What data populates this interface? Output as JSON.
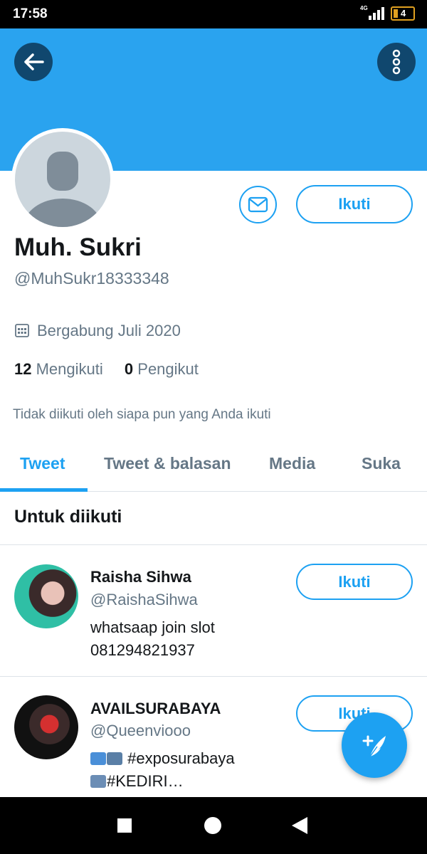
{
  "status_bar": {
    "time": "17:58",
    "network": "4G",
    "battery": "4"
  },
  "header": {
    "back_icon": "arrow-left-icon",
    "menu_icon": "more-vertical-icon"
  },
  "profile": {
    "name": "Muh. Sukri",
    "handle": "@MuhSukr18333348",
    "joined": "Bergabung Juli 2020",
    "following_count": "12",
    "following_label": "Mengikuti",
    "followers_count": "0",
    "followers_label": "Pengikut",
    "followed_by_note": "Tidak diikuti oleh siapa pun yang Anda ikuti",
    "follow_label": "Ikuti"
  },
  "tabs": [
    {
      "label": "Tweet",
      "active": true
    },
    {
      "label": "Tweet & balasan"
    },
    {
      "label": "Media"
    },
    {
      "label": "Suka"
    }
  ],
  "suggestions": {
    "title": "Untuk diikuti",
    "items": [
      {
        "name": "Raisha Sihwa",
        "handle": "@RaishaSihwa",
        "bio_line1": "whatsaap join slot",
        "bio_line2": "081294821937",
        "follow_label": "Ikuti"
      },
      {
        "name": "AVAILSURABAYA",
        "handle": "@Queenviooo",
        "bio_line1": "#exposurabaya",
        "bio_line2": "#KEDIRI…",
        "follow_label": "Ikuti"
      }
    ]
  },
  "colors": {
    "accent": "#1da1f2",
    "banner": "#2aa3ef",
    "dark_button": "#10476e"
  }
}
